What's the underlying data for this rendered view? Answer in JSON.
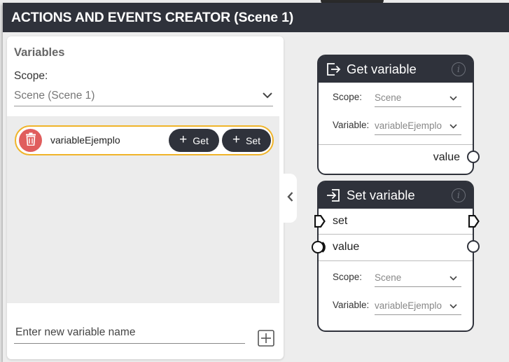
{
  "window": {
    "title": "ACTIONS AND EVENTS CREATOR (Scene 1)"
  },
  "variables_panel": {
    "heading": "Variables",
    "scope_label": "Scope:",
    "scope_value": "Scene (Scene 1)",
    "variables": [
      {
        "name": "variableEjemplo",
        "get_label": "Get",
        "set_label": "Set"
      }
    ],
    "new_variable_placeholder": "Enter new variable name"
  },
  "get_node": {
    "title": "Get variable",
    "scope_label": "Scope:",
    "scope_value": "Scene",
    "variable_label": "Variable:",
    "variable_value": "variableEjemplo",
    "output_label": "value"
  },
  "set_node": {
    "title": "Set variable",
    "flow_label": "set",
    "input_label": "value",
    "scope_label": "Scope:",
    "scope_value": "Scene",
    "variable_label": "Variable:",
    "variable_value": "variableEjemplo"
  },
  "icons": {
    "trash": "trash-icon",
    "collapse": "chevron-left-icon",
    "add": "plus-box-icon",
    "dropdown": "chevron-down-icon",
    "get": "exit-arrow-icon",
    "set": "enter-arrow-icon",
    "info": "info-icon"
  },
  "colors": {
    "title_bar": "#2f323b",
    "selection_border": "#f0b429",
    "delete": "#e05d5d"
  }
}
